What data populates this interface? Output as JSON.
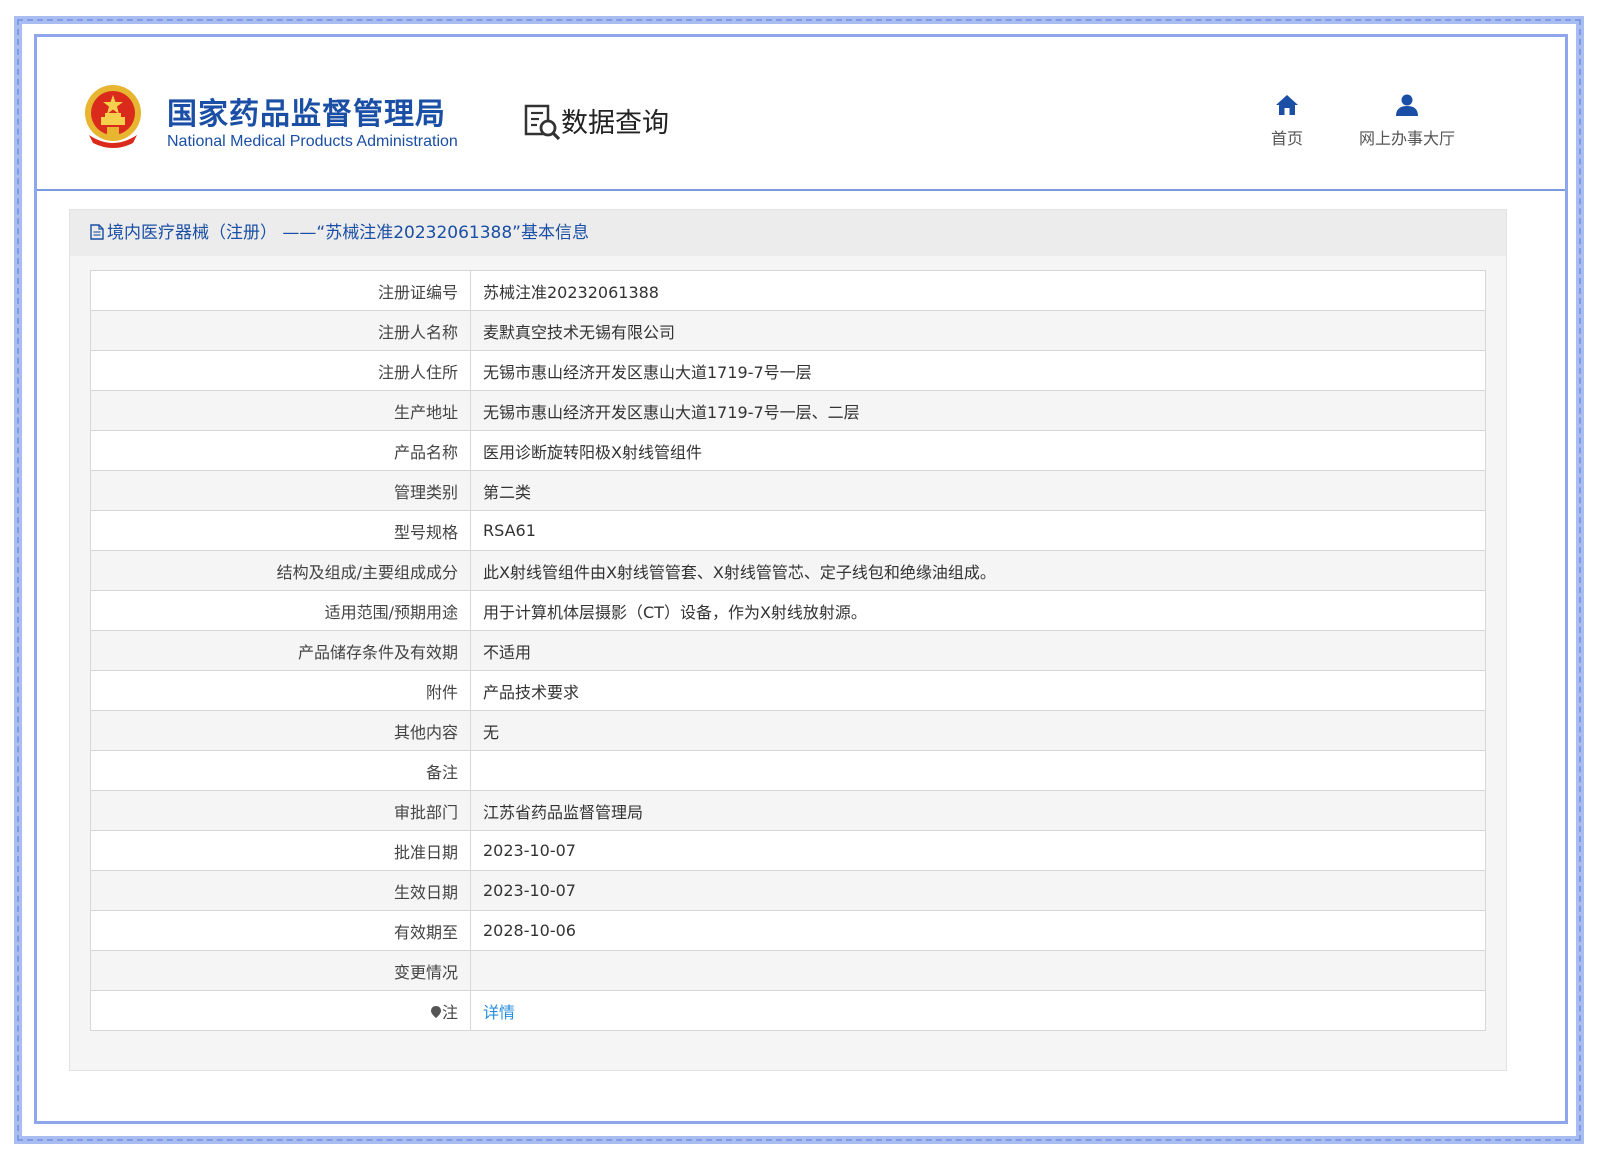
{
  "header": {
    "agency_cn": "国家药品监督管理局",
    "agency_en": "National Medical Products Administration",
    "section_title": "数据查询",
    "nav": [
      {
        "label": "首页",
        "icon": "home-icon"
      },
      {
        "label": "网上办事大厅",
        "icon": "user-icon"
      }
    ]
  },
  "content": {
    "title": "境内医疗器械（注册） ——“苏械注准20232061388”基本信息",
    "rows": [
      {
        "label": "注册证编号",
        "value": "苏械注准20232061388"
      },
      {
        "label": "注册人名称",
        "value": "麦默真空技术无锡有限公司"
      },
      {
        "label": "注册人住所",
        "value": "无锡市惠山经济开发区惠山大道1719-7号一层"
      },
      {
        "label": "生产地址",
        "value": "无锡市惠山经济开发区惠山大道1719-7号一层、二层"
      },
      {
        "label": "产品名称",
        "value": "医用诊断旋转阳极X射线管组件"
      },
      {
        "label": "管理类别",
        "value": "第二类"
      },
      {
        "label": "型号规格",
        "value": "RSA61"
      },
      {
        "label": "结构及组成/主要组成成分",
        "value": "此X射线管组件由X射线管管套、X射线管管芯、定子线包和绝缘油组成。"
      },
      {
        "label": "适用范围/预期用途",
        "value": "用于计算机体层摄影（CT）设备，作为X射线放射源。"
      },
      {
        "label": "产品储存条件及有效期",
        "value": "不适用"
      },
      {
        "label": "附件",
        "value": "产品技术要求"
      },
      {
        "label": "其他内容",
        "value": "无"
      },
      {
        "label": "备注",
        "value": ""
      },
      {
        "label": "审批部门",
        "value": "江苏省药品监督管理局"
      },
      {
        "label": "批准日期",
        "value": "2023-10-07"
      },
      {
        "label": "生效日期",
        "value": "2023-10-07"
      },
      {
        "label": "有效期至",
        "value": "2028-10-06"
      },
      {
        "label": "变更情况",
        "value": ""
      }
    ],
    "note_label": "注",
    "note_link": "详情"
  },
  "colors": {
    "brand_blue": "#1a4fa5",
    "link_blue": "#2a8de0",
    "frame_blue": "#a9bdf0"
  }
}
